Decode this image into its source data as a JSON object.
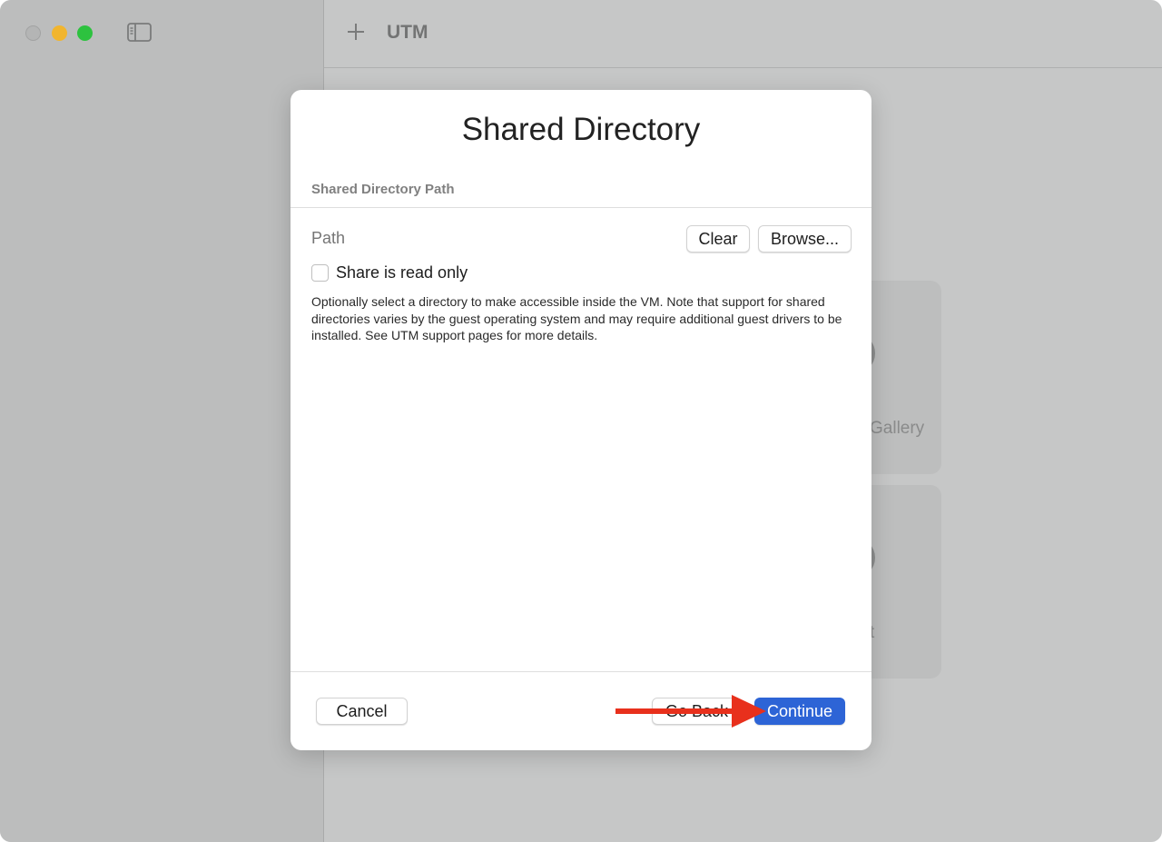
{
  "window": {
    "app_title": "UTM"
  },
  "background_cards": [
    {
      "label": "Gallery"
    },
    {
      "label": "t"
    }
  ],
  "dialog": {
    "title": "Shared Directory",
    "section_header": "Shared Directory Path",
    "path_placeholder": "Path",
    "path_value": "",
    "clear_label": "Clear",
    "browse_label": "Browse...",
    "read_only_label": "Share is read only",
    "read_only_checked": false,
    "help_text": "Optionally select a directory to make accessible inside the VM. Note that support for shared directories varies by the guest operating system and may require additional guest drivers to be installed. See UTM support pages for more details.",
    "cancel_label": "Cancel",
    "go_back_label": "Go Back",
    "continue_label": "Continue"
  },
  "colors": {
    "accent": "#2d64d6",
    "annotation_arrow": "#e8301c",
    "traffic_close": "#b4b5b5",
    "traffic_minimize": "#f1b52e",
    "traffic_maximize": "#2dc23f"
  }
}
